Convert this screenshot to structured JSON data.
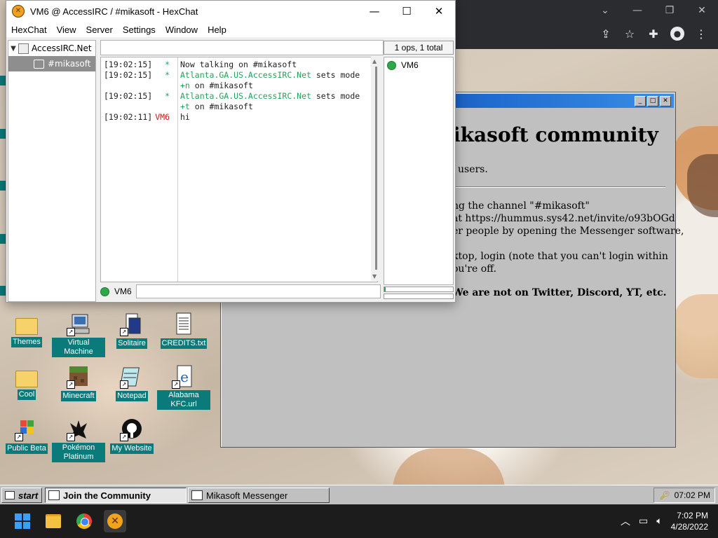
{
  "hexchat": {
    "title": "VM6 @ AccessIRC / #mikasoft - HexChat",
    "app_icon": "hexchat-icon",
    "menu": [
      "HexChat",
      "View",
      "Server",
      "Settings",
      "Window",
      "Help"
    ],
    "tree": {
      "network": "AccessIRC.Net",
      "channel": "#mikasoft"
    },
    "ops_label": "1 ops, 1 total",
    "messages": [
      {
        "time": "[19:02:15]",
        "nick": "*",
        "text": "Now talking on #mikasoft"
      },
      {
        "time": "[19:02:15]",
        "nick": "*",
        "text": "Atlanta.GA.US.AccessIRC.Net sets mode +n on #mikasoft"
      },
      {
        "time": "[19:02:15]",
        "nick": "*",
        "text": "Atlanta.GA.US.AccessIRC.Net sets mode +t on #mikasoft"
      },
      {
        "time": "[19:02:11]",
        "nick": "VM6",
        "text": "hi"
      }
    ],
    "m1": {
      "text": "Now talking on #mikasoft"
    },
    "m2": {
      "server": "Atlanta.GA.US.AccessIRC.Net",
      "pre": "sets mode ",
      "mode": "+n",
      "post": " on #mikasoft"
    },
    "m3": {
      "server": "Atlanta.GA.US.AccessIRC.Net",
      "pre": "sets mode ",
      "mode": "+t",
      "post": " on #mikasoft"
    },
    "users": [
      "VM6"
    ],
    "input_nick": "VM6",
    "input_value": ""
  },
  "web": {
    "heading": "Mikasoft community",
    "users_text": "users.",
    "lines": [
      "ng the channel \"#mikasoft\"",
      "at https://hummus.sys42.net/invite/o93bOGd",
      "er people by opening the Messenger software,",
      "ktop, login (note that you can't login within",
      "ou're off."
    ],
    "bold_line": "We are not on Twitter, Discord, YT, etc."
  },
  "desktop_icons": [
    {
      "label": "Themes",
      "icon": "folder-icon"
    },
    {
      "label": "Virtual Machine",
      "icon": "computer-icon"
    },
    {
      "label": "Solitaire",
      "icon": "solitaire-icon"
    },
    {
      "label": "CREDITS.txt",
      "icon": "text-file-icon"
    },
    {
      "label": "Cool",
      "icon": "folder-icon"
    },
    {
      "label": "Minecraft",
      "icon": "minecraft-icon"
    },
    {
      "label": "Notepad",
      "icon": "notepad-icon"
    },
    {
      "label": "Alabama KFC.url",
      "icon": "internet-shortcut-icon"
    },
    {
      "label": "Public Beta",
      "icon": "windows-flag-icon"
    },
    {
      "label": "Pokémon Platinum",
      "icon": "pokemon-icon"
    },
    {
      "label": "My Website",
      "icon": "github-icon"
    }
  ],
  "taskbar98": {
    "start": "start",
    "buttons": [
      "Join the Community",
      "Mikasoft Messenger"
    ],
    "clock": "07:02 PM"
  },
  "win11": {
    "time": "7:02 PM",
    "date": "4/28/2022",
    "apps": [
      "start-icon",
      "file-explorer-icon",
      "chrome-icon",
      "hexchat-icon"
    ]
  },
  "colors": {
    "hex_green": "#27a05a",
    "hex_red": "#cc1b1b",
    "desktop_label_bg": "#0a7a7a",
    "win98_gray": "#c0c0c0"
  }
}
